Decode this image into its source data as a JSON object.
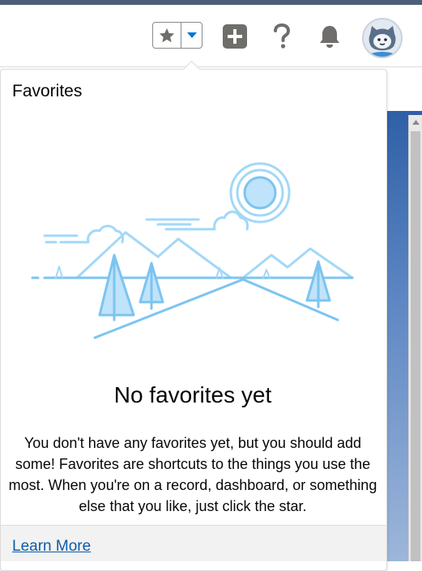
{
  "header": {
    "favorites_star_icon": "star-icon",
    "favorites_menu_icon": "chevron-down-icon",
    "global_actions_icon": "add-icon",
    "help_icon": "question-icon",
    "notifications_icon": "bell-icon",
    "avatar_icon": "astro-avatar"
  },
  "panel": {
    "title": "Favorites",
    "empty_title": "No favorites yet",
    "empty_body": "You don't have any favorites yet, but you should add some! Favorites are shortcuts to the things you use the most. When you're on a record, dashboard, or something else that you like, just click the star.",
    "learn_more": "Learn More"
  },
  "colors": {
    "accent": "#0176d3",
    "link": "#0b5cab",
    "illustration": "#a3d8f7",
    "illustration_dark": "#7cc4f0"
  }
}
